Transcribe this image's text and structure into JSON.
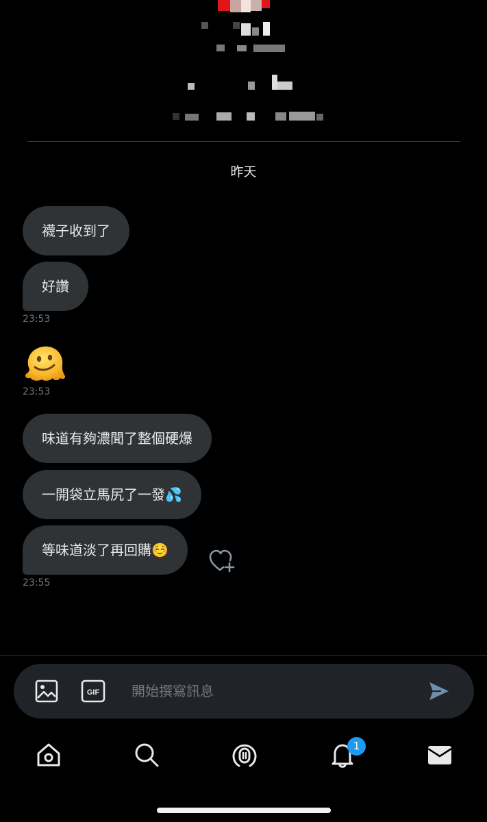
{
  "conversation": {
    "day_label": "昨天",
    "messages": [
      {
        "text": "襪子收到了"
      },
      {
        "text": "好讚",
        "time": "23:53"
      },
      {
        "emoji": "melting-face",
        "time": "23:53"
      },
      {
        "text": "味道有夠濃聞了整個硬爆"
      },
      {
        "text": "一開袋立馬尻了一發💦"
      },
      {
        "text": "等味道淡了再回購☺️",
        "time": "23:55"
      }
    ]
  },
  "composer": {
    "placeholder": "開始撰寫訊息",
    "gif_label": "GIF"
  },
  "bottom_nav": {
    "items": [
      "home-icon",
      "search-icon",
      "spaces-icon",
      "notifications-icon",
      "messages-icon"
    ],
    "notification_badge": "1"
  },
  "colors": {
    "background": "#000000",
    "bubble": "#2f3336",
    "composer": "#202327",
    "accent": "#1d9bf0",
    "muted_text": "#71767b"
  }
}
